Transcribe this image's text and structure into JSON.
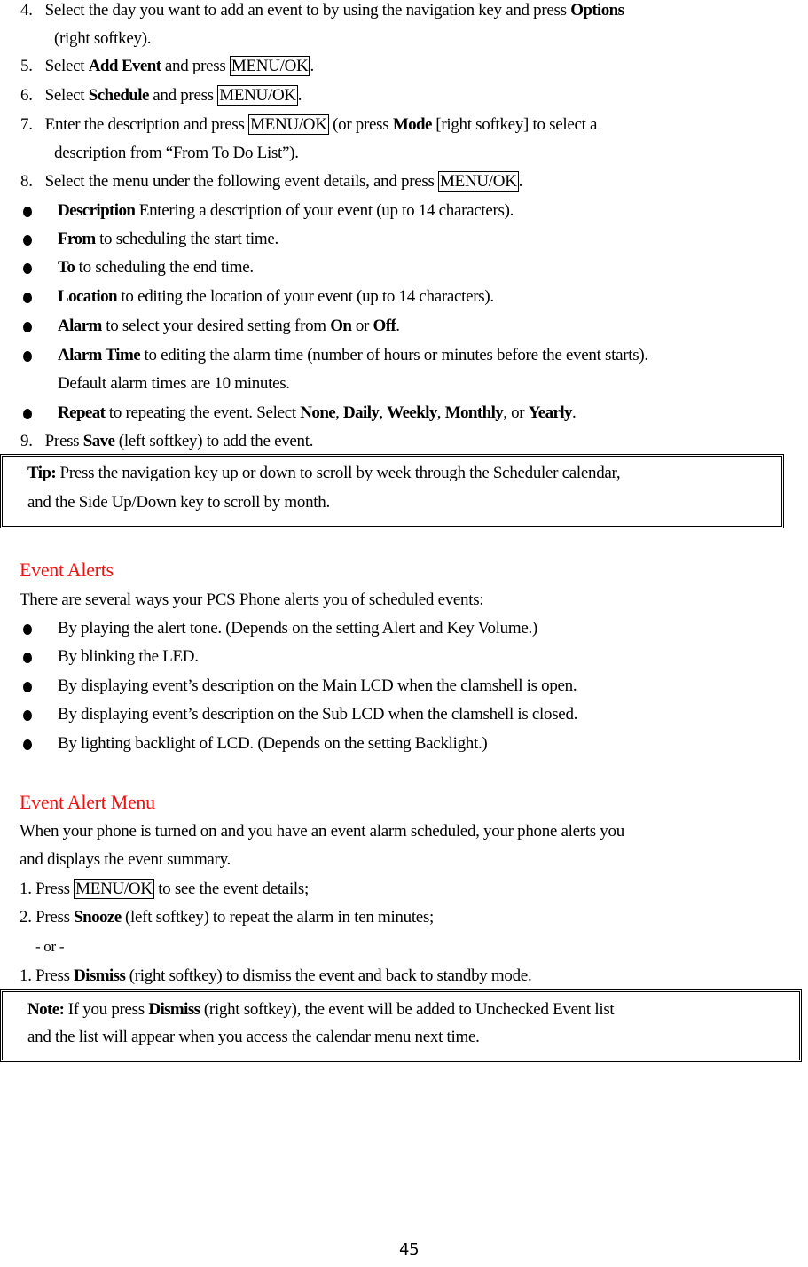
{
  "steps_top": [
    {
      "num": "4.",
      "pre": "Select the day you want to add an event to by using the navigation key and press ",
      "bold": "Options",
      "post": "",
      "cont": "(right softkey)."
    },
    {
      "num": "5.",
      "pre": "Select ",
      "bold": "Add Event",
      "mid": " and press ",
      "key": "MENU/OK",
      "post": "."
    },
    {
      "num": "6.",
      "pre": "Select ",
      "bold": "Schedule",
      "mid": " and press ",
      "key": "MENU/OK",
      "post": "."
    },
    {
      "num": "7.",
      "pre": "Enter the description and press ",
      "key": "MENU/OK",
      "mid": " (or press ",
      "bold": "Mode",
      "post": " [right softkey] to select a",
      "cont": "description from “From To Do List”)."
    },
    {
      "num": "8.",
      "pre": "Select the menu under the following event details, and press ",
      "key": "MENU/OK",
      "post": "."
    }
  ],
  "details": [
    {
      "bold": "Description",
      "text": " Entering a description of your event (up to 14 characters)."
    },
    {
      "bold": "From",
      "text": " to scheduling the start time."
    },
    {
      "bold": "To",
      "text": " to scheduling the end time."
    },
    {
      "bold": "Location",
      "text": " to editing the location of your event (up to 14 characters)."
    },
    {
      "bold": "Alarm",
      "text": " to select your desired setting from ",
      "b2": "On",
      "t2": " or ",
      "b3": "Off",
      "t3": "."
    },
    {
      "bold": "Alarm Time",
      "text": " to editing the alarm time (number of hours or minutes before the event starts).",
      "cont": "Default alarm times are 10 minutes."
    },
    {
      "bold": "Repeat",
      "text": " to repeating the event. Select ",
      "opts": [
        "None",
        "Daily",
        "Weekly",
        "Monthly",
        "Yearly"
      ],
      "or": "or"
    }
  ],
  "step9": {
    "num": "9.",
    "pre": "Press ",
    "bold": "Save",
    "post": " (left softkey) to add the event."
  },
  "tip": {
    "label": "Tip:",
    "line1": " Press the navigation key up or down to scroll by week through the Scheduler calendar,",
    "line2": "and the Side Up/Down key to scroll by month."
  },
  "event_alerts": {
    "heading": "Event Alerts",
    "intro": "There are several ways your PCS Phone alerts you of scheduled events:",
    "items": [
      "By playing the alert tone. (Depends on the setting Alert and Key Volume.)",
      "By blinking the LED.",
      "By displaying event’s description on the Main LCD when the clamshell is open.",
      "By displaying event’s description on the Sub LCD when the clamshell is closed.",
      "By lighting backlight of LCD. (Depends on the setting Backlight.)"
    ]
  },
  "alert_menu": {
    "heading": "Event Alert Menu",
    "intro1": "When your phone is turned on and you have an event alarm scheduled, your phone alerts you",
    "intro2": "and displays the event summary.",
    "s1_pre": "1. Press ",
    "s1_key": "MENU/OK",
    "s1_post": " to see the event details;",
    "s2_pre": "2. Press ",
    "s2_bold": "Snooze",
    "s2_post": " (left softkey) to repeat the alarm in ten minutes;",
    "or": "- or -",
    "s3_pre": "1. Press ",
    "s3_bold": "Dismiss",
    "s3_post": " (right softkey) to dismiss the event and back to standby mode."
  },
  "note": {
    "label": "Note:",
    "pre": " If you press ",
    "bold": "Dismiss",
    "post": " (right softkey), the event will be added to Unchecked Event list",
    "line2": "and the list will appear when you access the calendar menu next time."
  },
  "page_number": "45"
}
